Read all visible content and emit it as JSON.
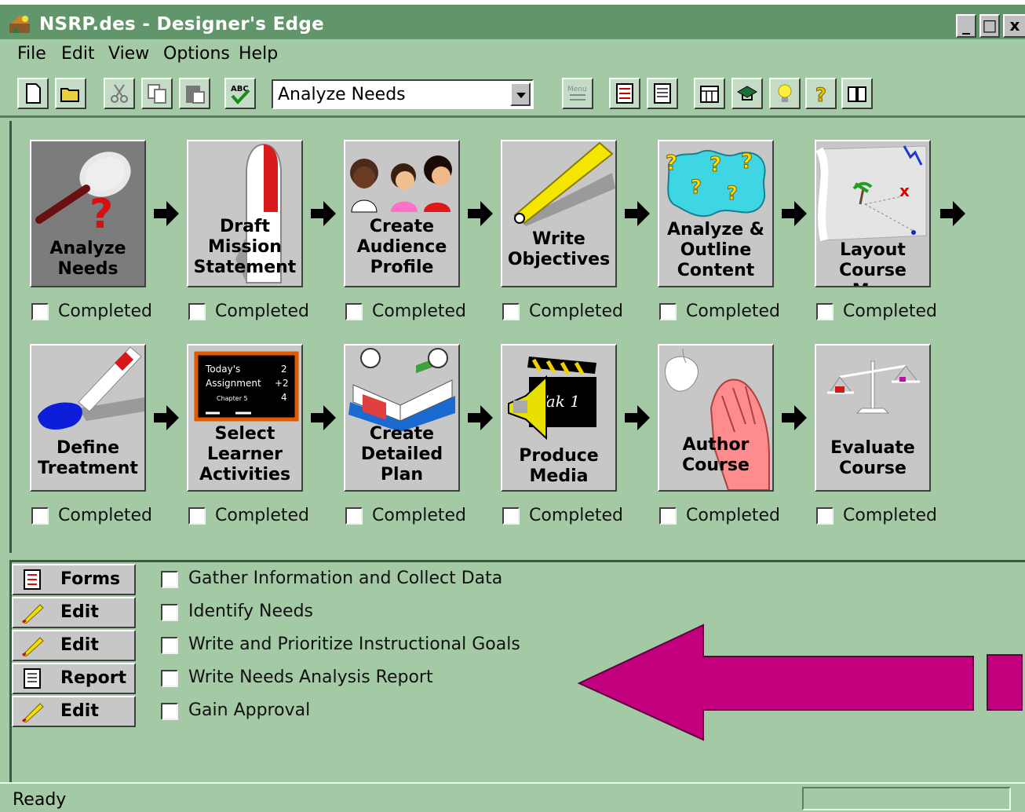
{
  "window": {
    "title": "NSRP.des - Designer's Edge",
    "controls": [
      "_",
      "□",
      "x"
    ]
  },
  "menu": [
    "File",
    "Edit",
    "View",
    "Options",
    "Help"
  ],
  "toolbar": {
    "phase_select": "Analyze Needs",
    "icons": [
      "new-icon",
      "open-icon",
      "cut-icon",
      "copy-icon",
      "paste-icon",
      "spellcheck-icon",
      "menu-icon",
      "checklist-icon",
      "report-icon",
      "calendar-icon",
      "course-icon",
      "idea-icon",
      "help-icon",
      "book-icon"
    ]
  },
  "steps": [
    {
      "label": "Analyze\nNeeds",
      "completed_label": "Completed",
      "active": true
    },
    {
      "label": "Draft\nMission\nStatement",
      "completed_label": "Completed"
    },
    {
      "label": "Create\nAudience\nProfile",
      "completed_label": "Completed"
    },
    {
      "label": "Write\nObjectives",
      "completed_label": "Completed"
    },
    {
      "label": "Analyze &\nOutline\nContent",
      "completed_label": "Completed"
    },
    {
      "label": "Layout\nCourse Map",
      "completed_label": "Completed"
    },
    {
      "label": "Define\nTreatment",
      "completed_label": "Completed"
    },
    {
      "label": "Select\nLearner\nActivities",
      "completed_label": "Completed"
    },
    {
      "label": "Create\nDetailed\nPlan",
      "completed_label": "Completed"
    },
    {
      "label": "Produce\nMedia",
      "completed_label": "Completed"
    },
    {
      "label": "Author\nCourse",
      "completed_label": "Completed"
    },
    {
      "label": "Evaluate\nCourse",
      "completed_label": "Completed"
    }
  ],
  "chalkboard": {
    "line1": "Today's",
    "line2": "Assignment",
    "line3": "Chapter 5",
    "n1": "2",
    "n2": "+2",
    "n3": "4"
  },
  "clapper": {
    "text": "Tak 1"
  },
  "tasks": [
    {
      "button": "Forms",
      "icon": "forms-icon",
      "label": "Gather Information and Collect Data"
    },
    {
      "button": "Edit",
      "icon": "pencil-icon",
      "label": "Identify Needs"
    },
    {
      "button": "Edit",
      "icon": "pencil-icon",
      "label": "Write and Prioritize Instructional Goals"
    },
    {
      "button": "Report",
      "icon": "report-icon",
      "label": "Write Needs Analysis Report"
    },
    {
      "button": "Edit",
      "icon": "pencil-icon",
      "label": "Gain Approval"
    }
  ],
  "status": {
    "text": "Ready"
  },
  "colors": {
    "panel": "#a3c9a5",
    "titlebar": "#61956a",
    "highlight_arrow": "#c2007e"
  }
}
